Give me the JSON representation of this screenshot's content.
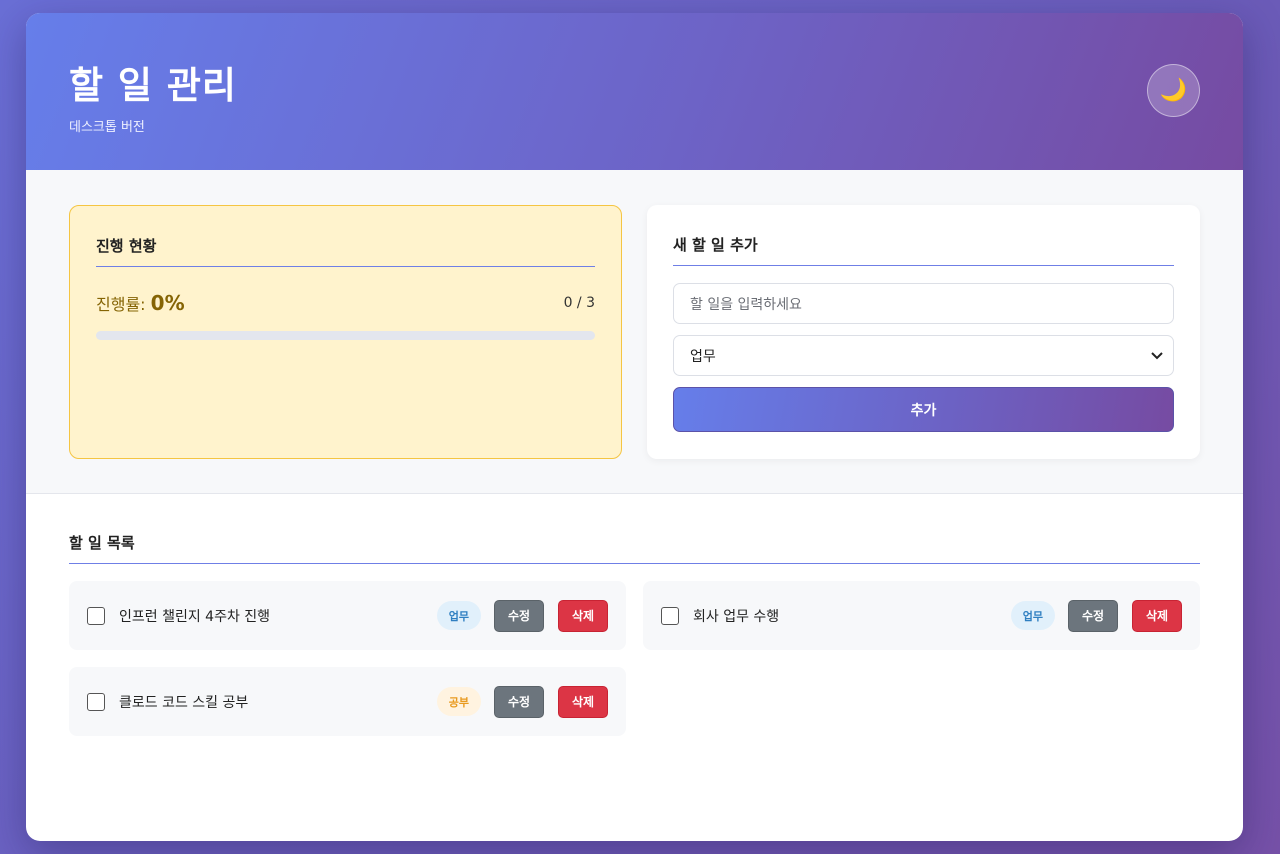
{
  "header": {
    "title": "할 일 관리",
    "subtitle": "데스크톱 버전",
    "theme_icon": "moon-icon",
    "theme_glyph": "🌙"
  },
  "progress": {
    "title": "진행 현황",
    "label": "진행률:",
    "percent_text": "0%",
    "percent_value": 0,
    "count_text": "0 / 3"
  },
  "add_form": {
    "title": "새 할 일 추가",
    "input_placeholder": "할 일을 입력하세요",
    "category_selected": "업무",
    "add_label": "추가"
  },
  "list": {
    "title": "할 일 목록",
    "items": [
      {
        "text": "인프런 챌린지 4주차 진행",
        "category": "업무",
        "edit_label": "수정",
        "delete_label": "삭제",
        "done": false
      },
      {
        "text": "회사 업무 수행",
        "category": "업무",
        "edit_label": "수정",
        "delete_label": "삭제",
        "done": false
      },
      {
        "text": "클로드 코드 스킬 공부",
        "category": "공부",
        "edit_label": "수정",
        "delete_label": "삭제",
        "done": false
      }
    ]
  },
  "colors": {
    "accent": "#667eea",
    "accent_end": "#764ba2",
    "delete": "#dc3545",
    "edit": "#6c757d",
    "progress_bg": "#fff3cd"
  }
}
